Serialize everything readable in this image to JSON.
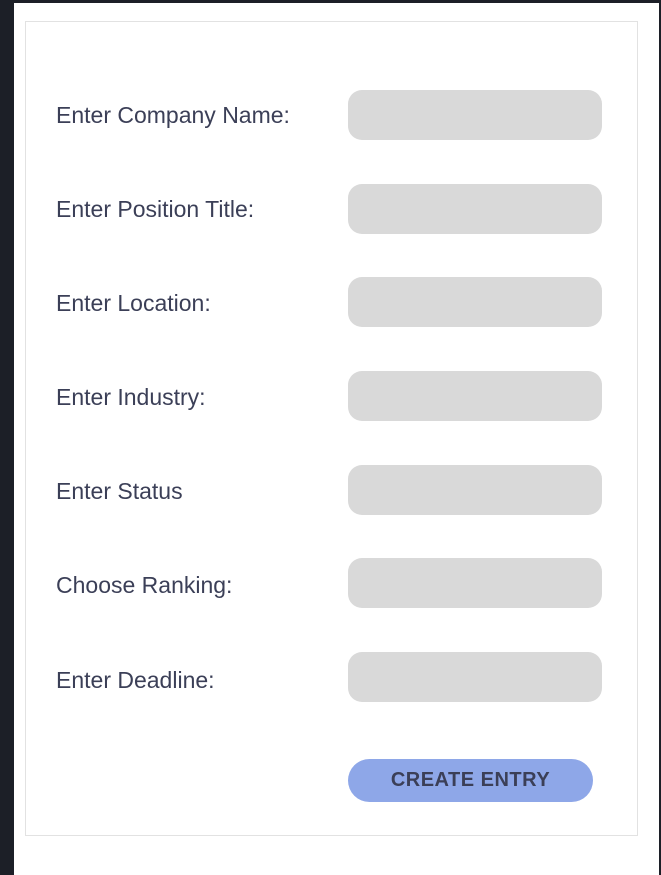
{
  "form": {
    "fields": [
      {
        "label": "Enter Company Name:",
        "value": "",
        "placeholder": ""
      },
      {
        "label": "Enter Position Title:",
        "value": "",
        "placeholder": ""
      },
      {
        "label": "Enter Location:",
        "value": "",
        "placeholder": ""
      },
      {
        "label": "Enter Industry:",
        "value": "",
        "placeholder": ""
      },
      {
        "label": "Enter Status",
        "value": "",
        "placeholder": ""
      },
      {
        "label": "Choose Ranking:",
        "value": "",
        "placeholder": ""
      },
      {
        "label": "Enter Deadline:",
        "value": "",
        "placeholder": ""
      }
    ],
    "submit_label": "CREATE ENTRY"
  },
  "colors": {
    "background_dark": "#1c1f27",
    "input_fill": "#d9d9d9",
    "label_text": "#3b3f57",
    "button_fill": "#8ea7e8"
  }
}
